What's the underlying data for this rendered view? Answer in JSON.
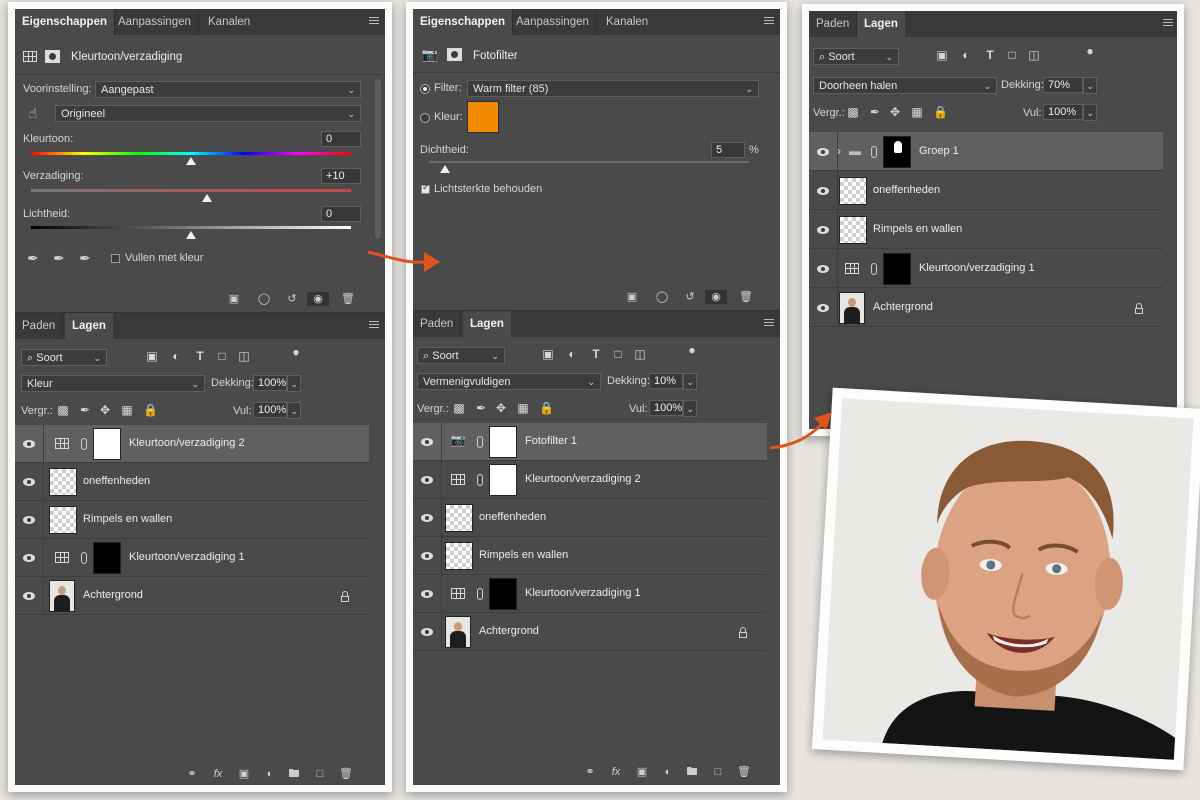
{
  "panel1": {
    "tabs": [
      "Eigenschappen",
      "Aanpassingen",
      "Kanalen"
    ],
    "title": "Kleurtoon/verzadiging",
    "preset_label": "Voorinstelling:",
    "preset_value": "Aangepast",
    "channel_value": "Origineel",
    "hue_label": "Kleurtoon:",
    "hue_value": "0",
    "hue_level": 0.5,
    "sat_label": "Verzadiging:",
    "sat_value": "+10",
    "sat_level": 0.55,
    "light_label": "Lichtheid:",
    "light_value": "0",
    "light_level": 0.5,
    "colorize_label": "Vullen met kleur",
    "layers_tabs": [
      "Paden",
      "Lagen"
    ],
    "filter_kind": "Soort",
    "blend_mode": "Kleur",
    "opacity_label": "Dekking:",
    "opacity_value": "100%",
    "lock_label": "Vergr.:",
    "fill_label": "Vul:",
    "fill_value": "100%",
    "layers": [
      {
        "name": "Kleurtoon/verzadiging 2",
        "kind": "adjustment",
        "mask": "white",
        "selected": true
      },
      {
        "name": "oneffenheden",
        "kind": "pixel"
      },
      {
        "name": "Rimpels en wallen",
        "kind": "pixel"
      },
      {
        "name": "Kleurtoon/verzadiging 1",
        "kind": "adjustment",
        "mask": "black"
      },
      {
        "name": "Achtergrond",
        "kind": "background",
        "locked": true
      }
    ]
  },
  "panel2": {
    "tabs": [
      "Eigenschappen",
      "Aanpassingen",
      "Kanalen"
    ],
    "title": "Fotofilter",
    "filter_label": "Filter:",
    "filter_value": "Warm filter (85)",
    "color_label": "Kleur:",
    "swatch_color": "#f08a00",
    "density_label": "Dichtheid:",
    "density_value": "5",
    "density_unit": "%",
    "density_level": 0.05,
    "preserve_label": "Lichtsterkte behouden",
    "layers_tabs": [
      "Paden",
      "Lagen"
    ],
    "filter_kind": "Soort",
    "blend_mode": "Vermenigvuldigen",
    "opacity_label": "Dekking:",
    "opacity_value": "10%",
    "lock_label": "Vergr.:",
    "fill_label": "Vul:",
    "fill_value": "100%",
    "layers": [
      {
        "name": "Fotofilter 1",
        "kind": "photofilter",
        "mask": "white",
        "selected": true
      },
      {
        "name": "Kleurtoon/verzadiging 2",
        "kind": "adjustment",
        "mask": "white"
      },
      {
        "name": "oneffenheden",
        "kind": "pixel"
      },
      {
        "name": "Rimpels en wallen",
        "kind": "pixel"
      },
      {
        "name": "Kleurtoon/verzadiging 1",
        "kind": "adjustment",
        "mask": "black"
      },
      {
        "name": "Achtergrond",
        "kind": "background",
        "locked": true
      }
    ]
  },
  "panel3": {
    "tabs": [
      "Paden",
      "Lagen"
    ],
    "filter_kind": "Soort",
    "blend_mode": "Doorheen halen",
    "opacity_label": "Dekking:",
    "opacity_value": "70%",
    "lock_label": "Vergr.:",
    "fill_label": "Vul:",
    "fill_value": "100%",
    "layers": [
      {
        "name": "Groep 1",
        "kind": "group",
        "mask": "black-figure",
        "selected": true
      },
      {
        "name": "oneffenheden",
        "kind": "pixel"
      },
      {
        "name": "Rimpels en wallen",
        "kind": "pixel"
      },
      {
        "name": "Kleurtoon/verzadiging 1",
        "kind": "adjustment",
        "mask": "black"
      },
      {
        "name": "Achtergrond",
        "kind": "background",
        "locked": true
      }
    ]
  },
  "colors": {
    "arrow": "#e0541c",
    "panel_bg": "#4a4a4a",
    "tab_bg": "#393939",
    "selected_layer": "#606060"
  }
}
